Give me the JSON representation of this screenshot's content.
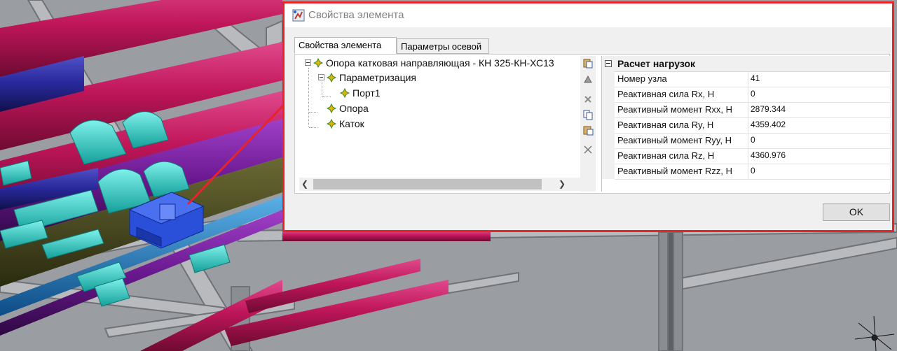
{
  "window": {
    "title": "Свойства элемента",
    "icon": "element-properties-icon"
  },
  "tabs": [
    {
      "label": "Свойства элемента",
      "active": true
    },
    {
      "label": "Параметры осевой",
      "active": false
    }
  ],
  "tree": {
    "root": {
      "label": "Опора катковая направляющая - КН 325-КН-ХС13",
      "expanded": true
    },
    "items": [
      {
        "label": "Параметризация",
        "expanded": true
      },
      {
        "label": "Порт1"
      },
      {
        "label": "Опора"
      },
      {
        "label": "Каток"
      }
    ]
  },
  "toolbar": {
    "icons": [
      "paste-icon",
      "stamp-icon",
      "delete-icon",
      "copy-icon",
      "paste-special-icon",
      "clear-icon"
    ]
  },
  "property_grid": {
    "category": "Расчет нагрузок",
    "rows": [
      {
        "name": "Номер узла",
        "value": "41"
      },
      {
        "name": "Реактивная сила Rx, H",
        "value": "0"
      },
      {
        "name": "Реактивный момент Rxx, H",
        "value": "2879.344"
      },
      {
        "name": "Реактивная сила Ry, H",
        "value": "4359.402"
      },
      {
        "name": "Реактивный момент Ryy, H",
        "value": "0"
      },
      {
        "name": "Реактивная сила Rz, H",
        "value": "4360.976"
      },
      {
        "name": "Реактивный момент Rzz, H",
        "value": "0"
      }
    ]
  },
  "buttons": {
    "ok": "OK"
  },
  "colors": {
    "highlight_border": "#e8232a",
    "pipe_magenta": "#c8185c",
    "pipe_teal": "#2fd0c8",
    "pipe_purple": "#7a1fa0",
    "pipe_blue": "#1a6fb0",
    "support_blue": "#2a4fd8"
  }
}
